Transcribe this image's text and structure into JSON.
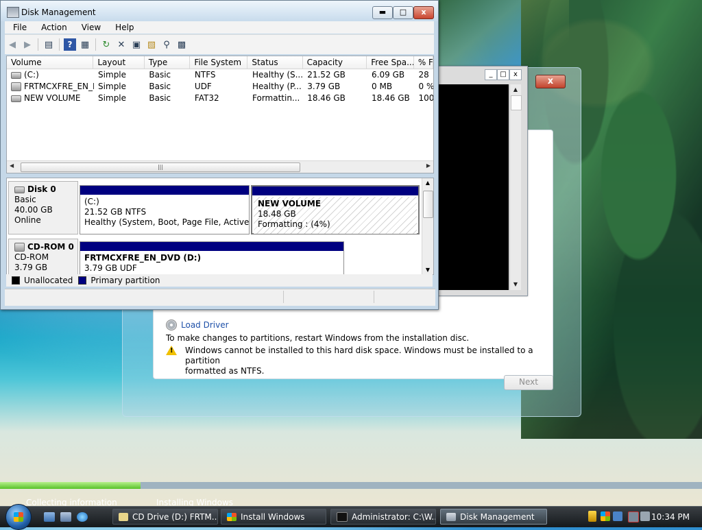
{
  "setup": {
    "load_driver": "Load Driver",
    "restart_msg": "To make changes to partitions, restart Windows from the installation disc.",
    "warning_line1": "Windows cannot be installed to this hard disk space. Windows must be installed to a partition",
    "warning_line2": "formatted as NTFS.",
    "next_label": "Next",
    "close_glyph": "x"
  },
  "console": {
    "min_glyph": "_",
    "max_glyph": "□",
    "close_glyph": "x"
  },
  "disk_mgmt": {
    "title": "Disk Management",
    "window": {
      "min": "▬",
      "max": "□",
      "close": "x"
    },
    "menu": [
      "File",
      "Action",
      "View",
      "Help"
    ],
    "columns": [
      "Volume",
      "Layout",
      "Type",
      "File System",
      "Status",
      "Capacity",
      "Free Spa...",
      "% F"
    ],
    "rows": [
      [
        "(C:)",
        "Simple",
        "Basic",
        "NTFS",
        "Healthy (S...",
        "21.52 GB",
        "6.09 GB",
        "28"
      ],
      [
        "FRTMCXFRE_EN_D...",
        "Simple",
        "Basic",
        "UDF",
        "Healthy (P...",
        "3.79 GB",
        "0 MB",
        "0 %"
      ],
      [
        "NEW VOLUME",
        "Simple",
        "Basic",
        "FAT32",
        "Formattin...",
        "18.46 GB",
        "18.46 GB",
        "100"
      ]
    ],
    "disk0": {
      "name": "Disk 0",
      "kind": "Basic",
      "size": "40.00 GB",
      "state": "Online",
      "part_c": {
        "name": "(C:)",
        "size": "21.52 GB NTFS",
        "status": "Healthy (System, Boot, Page File, Active, Cra"
      },
      "part_new": {
        "name": "NEW VOLUME",
        "size": "18.48 GB",
        "status": "Formatting : (4%)"
      }
    },
    "cdrom0": {
      "name": "CD-ROM 0",
      "kind": "CD-ROM",
      "size": "3.79 GB",
      "part": {
        "name": "FRTMCXFRE_EN_DVD  (D:)",
        "size": "3.79 GB UDF"
      }
    },
    "legend": {
      "unallocated": "Unallocated",
      "primary": "Primary partition"
    },
    "colors": {
      "primary": "#000080",
      "unallocated": "#000000"
    }
  },
  "install_progress": {
    "fraction": 0.2,
    "step1": "Collecting information",
    "step2": "Installing Windows"
  },
  "taskbar": {
    "tasks": [
      {
        "label": "CD Drive (D:) FRTM..."
      },
      {
        "label": "Install Windows"
      },
      {
        "label": "Administrator: C:\\W..."
      },
      {
        "label": "Disk Management"
      }
    ],
    "clock": "10:34 PM"
  }
}
